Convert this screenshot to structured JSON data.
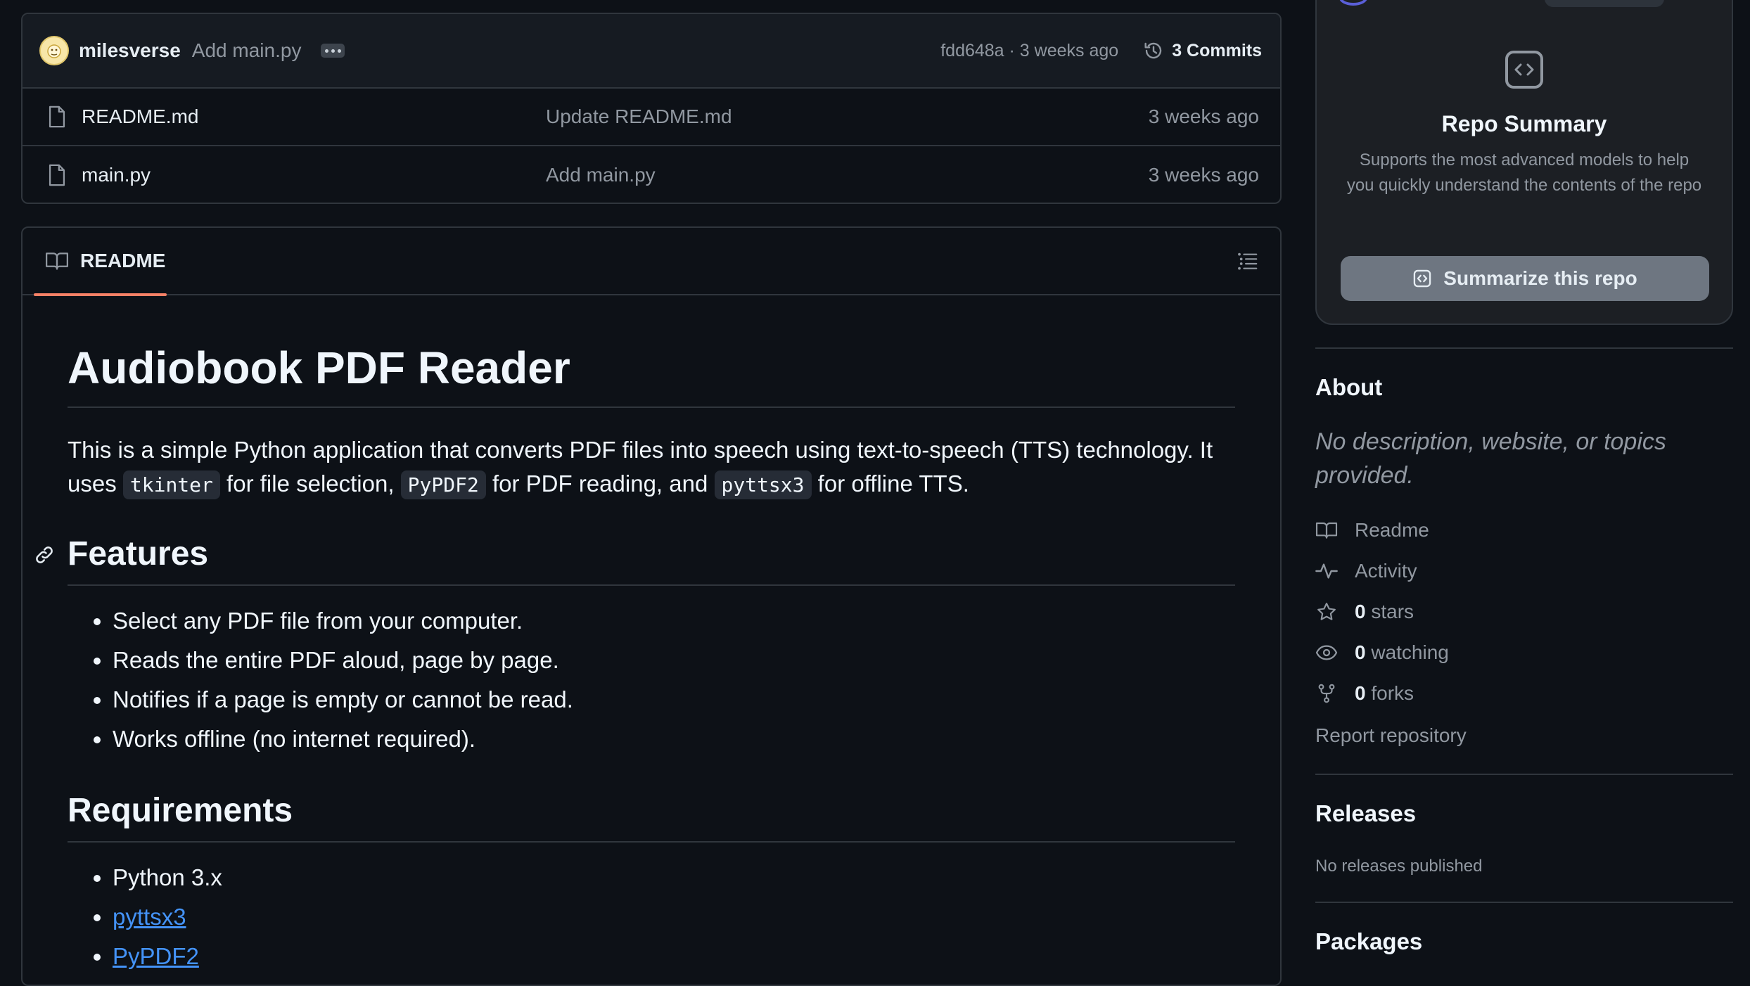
{
  "commit_bar": {
    "author": "milesverse",
    "message": "Add main.py",
    "meta": "fdd648a · 3 weeks ago",
    "commits_label": "3 Commits"
  },
  "files": [
    {
      "name": "README.md",
      "commit": "Update README.md",
      "age": "3 weeks ago"
    },
    {
      "name": "main.py",
      "commit": "Add main.py",
      "age": "3 weeks ago"
    }
  ],
  "readme": {
    "tab_label": "README",
    "title": "Audiobook PDF Reader",
    "intro": {
      "part1": "This is a simple Python application that converts PDF files into speech using text-to-speech (TTS) technology. It uses ",
      "code1": "tkinter",
      "part2": " for file selection, ",
      "code2": "PyPDF2",
      "part3": " for PDF reading, and ",
      "code3": "pyttsx3",
      "part4": " for offline TTS."
    },
    "features_heading": "Features",
    "features": [
      "Select any PDF file from your computer.",
      "Reads the entire PDF aloud, page by page.",
      "Notifies if a page is empty or cannot be read.",
      "Works offline (no internet required)."
    ],
    "requirements_heading": "Requirements",
    "requirements": [
      "Python 3.x",
      "pyttsx3",
      "PyPDF2"
    ]
  },
  "summary": {
    "title": "Repo Summary",
    "description": "Supports the most advanced models to help you quickly understand the contents of the repo",
    "button_label": "Summarize this repo"
  },
  "about": {
    "heading": "About",
    "description": "No description, website, or topics provided.",
    "readme_label": "Readme",
    "activity_label": "Activity",
    "stars_count": "0",
    "stars_label": "stars",
    "watching_count": "0",
    "watching_label": "watching",
    "forks_count": "0",
    "forks_label": "forks",
    "report_label": "Report repository"
  },
  "releases": {
    "heading": "Releases",
    "empty_text": "No releases published"
  },
  "packages": {
    "heading": "Packages"
  },
  "colors": {
    "background": "#0d1117",
    "accent_underline": "#f78166",
    "link": "#4493f8"
  }
}
